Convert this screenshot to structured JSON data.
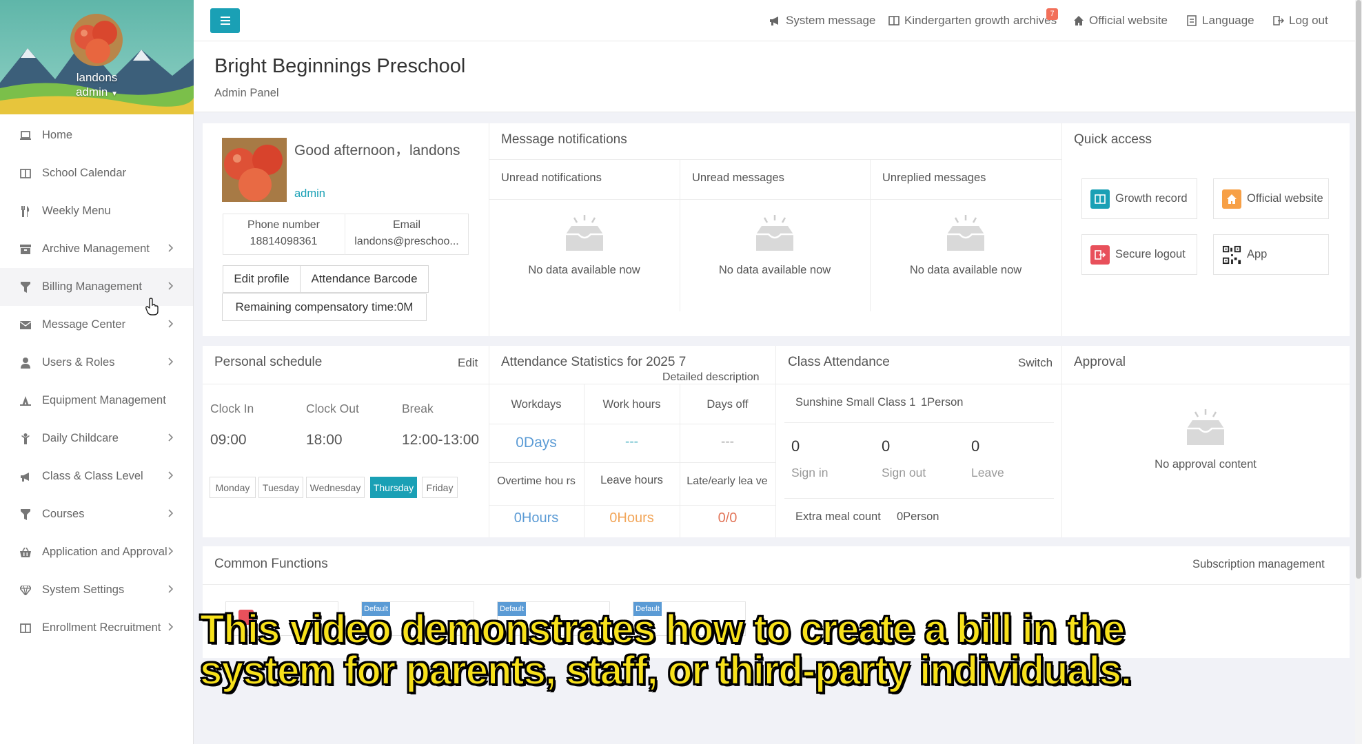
{
  "sidebar": {
    "user": {
      "name": "landons",
      "role": "admin"
    },
    "items": [
      {
        "label": "Home",
        "icon": "laptop-icon",
        "has_children": false
      },
      {
        "label": "School Calendar",
        "icon": "columns-icon",
        "has_children": false
      },
      {
        "label": "Weekly Menu",
        "icon": "cutlery-icon",
        "has_children": false
      },
      {
        "label": "Archive Management",
        "icon": "archive-icon",
        "has_children": true
      },
      {
        "label": "Billing Management",
        "icon": "filter-icon",
        "has_children": true
      },
      {
        "label": "Message Center",
        "icon": "envelope-icon",
        "has_children": true
      },
      {
        "label": "Users & Roles",
        "icon": "user-icon",
        "has_children": true
      },
      {
        "label": "Equipment Management",
        "icon": "equipment-icon",
        "has_children": false
      },
      {
        "label": "Daily Childcare",
        "icon": "child-icon",
        "has_children": true
      },
      {
        "label": "Class & Class Level",
        "icon": "bullhorn-icon",
        "has_children": true
      },
      {
        "label": "Courses",
        "icon": "filter-icon",
        "has_children": true
      },
      {
        "label": "Application and Approval",
        "icon": "basket-icon",
        "has_children": true
      },
      {
        "label": "System Settings",
        "icon": "diamond-icon",
        "has_children": true
      },
      {
        "label": "Enrollment Recruitment",
        "icon": "columns-icon",
        "has_children": true
      }
    ]
  },
  "topbar": {
    "system_message": "System message",
    "growth_archives": "Kindergarten growth archives",
    "growth_badge": "7",
    "official_website": "Official website",
    "language": "Language",
    "logout": "Log out"
  },
  "header": {
    "title": "Bright Beginnings Preschool",
    "subtitle": "Admin Panel"
  },
  "profile": {
    "greeting": "Good afternoon，landons",
    "role": "admin",
    "phone_label": "Phone number",
    "phone": "18814098361",
    "email_label": "Email",
    "email": "landons@preschoo...",
    "edit_profile": "Edit profile",
    "attendance_barcode": "Attendance Barcode",
    "compensatory": "Remaining compensatory time:0M"
  },
  "messages": {
    "title": "Message notifications",
    "columns": [
      "Unread notifications",
      "Unread messages",
      "Unreplied messages"
    ],
    "empty": "No data available now"
  },
  "quick_access": {
    "title": "Quick access",
    "items": [
      "Growth record",
      "Official website",
      "Secure logout",
      "App"
    ],
    "colors": {
      "growth": "#1aa0b5",
      "website": "#f7a046",
      "logout": "#e8505b"
    }
  },
  "schedule": {
    "title": "Personal schedule",
    "edit": "Edit",
    "labels": [
      "Clock In",
      "Clock Out",
      "Break"
    ],
    "values": [
      "09:00",
      "18:00",
      "12:00-13:00"
    ],
    "days": [
      "Monday",
      "Tuesday",
      "Wednesday",
      "Thursday",
      "Friday"
    ],
    "active_day": "Thursday"
  },
  "attendance_stats": {
    "title": "Attendance Statistics for 2025 7",
    "detail": "Detailed description",
    "headers": [
      "Workdays",
      "Work hours",
      "Days off"
    ],
    "values": [
      "0Days",
      "---",
      "---"
    ],
    "headers2": [
      "Overtime hou rs",
      "Leave hours",
      "Late/early lea ve"
    ],
    "values2": [
      "0Hours",
      "0Hours",
      "0/0"
    ]
  },
  "class_attendance": {
    "title": "Class Attendance",
    "switch": "Switch",
    "class_name": "Sunshine Small Class 1",
    "class_count": "1Person",
    "counts": [
      "0",
      "0",
      "0"
    ],
    "labels": [
      "Sign in",
      "Sign out",
      "Leave"
    ],
    "extra_meal_label": "Extra meal count",
    "extra_meal_value": "0Person"
  },
  "approval": {
    "title": "Approval",
    "empty": "No approval content"
  },
  "common_functions": {
    "title": "Common Functions",
    "subscription": "Subscription management",
    "tag": "Default"
  },
  "caption": {
    "line1": "This video demonstrates how to create a bill in the",
    "line2": "system for parents, staff, or third-party individuals."
  }
}
